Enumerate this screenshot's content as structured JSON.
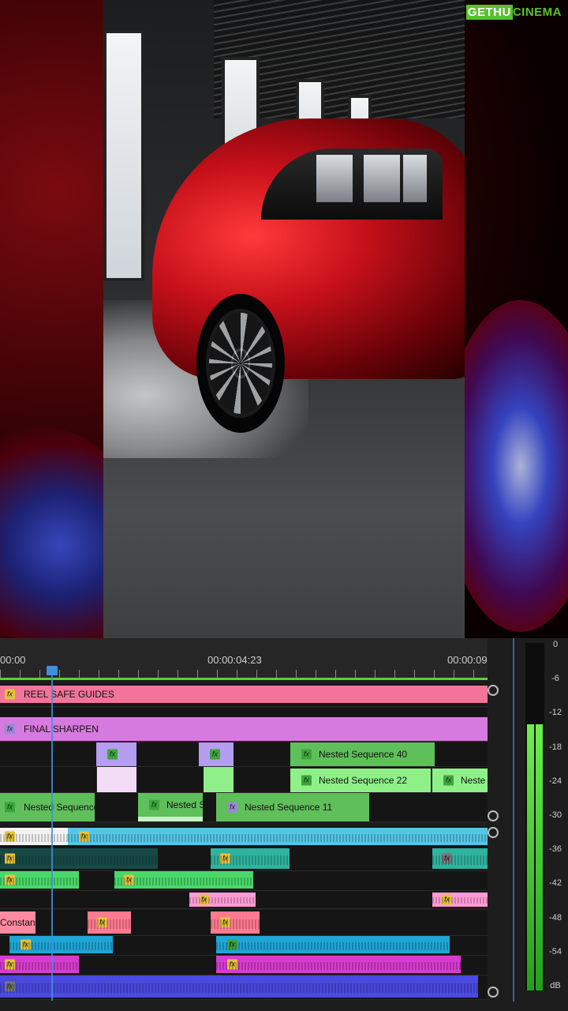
{
  "watermark": {
    "part1": "GETHU",
    "part2": "CINEMA"
  },
  "timeline": {
    "timecodes": [
      "00:00",
      "00:00:04:23",
      "00:00:09"
    ],
    "clips": {
      "reel_safe": "REEL SAFE GUIDES",
      "final_sharpen": "FINAL SHARPEN",
      "nested_40": "Nested Sequence 40",
      "nested_22": "Nested Sequence 22",
      "neste_trunc": "Neste",
      "nested_seq": "Nested Sequence",
      "nested_s": "Nested S",
      "nested_11": "Nested Sequence 11",
      "constant": "Constant"
    },
    "fx_label": "fx"
  },
  "meter": {
    "db_scale": [
      "0",
      "-6",
      "-12",
      "-18",
      "-24",
      "-30",
      "-36",
      "-42",
      "-48",
      "-54",
      "dB"
    ],
    "left_level_db": -14,
    "right_level_db": -14
  },
  "colors": {
    "reel": "#f4739a",
    "sharpen": "#d77ae0",
    "nested_green": "#5fbf5a",
    "light_green": "#8ff08a",
    "lavender": "#b59df0",
    "cyan_audio": "#55c6e6",
    "teal_audio": "#2fb3a0",
    "green_audio": "#49d86a",
    "pink_audio": "#ff9bd6",
    "salmon_audio": "#ff7a8f",
    "blue_audio": "#1fa5d6",
    "magenta_audio": "#d63cd0",
    "navy_audio": "#4a49e0",
    "work_bar": "#59cf3a",
    "playhead": "#3e8fe0"
  }
}
